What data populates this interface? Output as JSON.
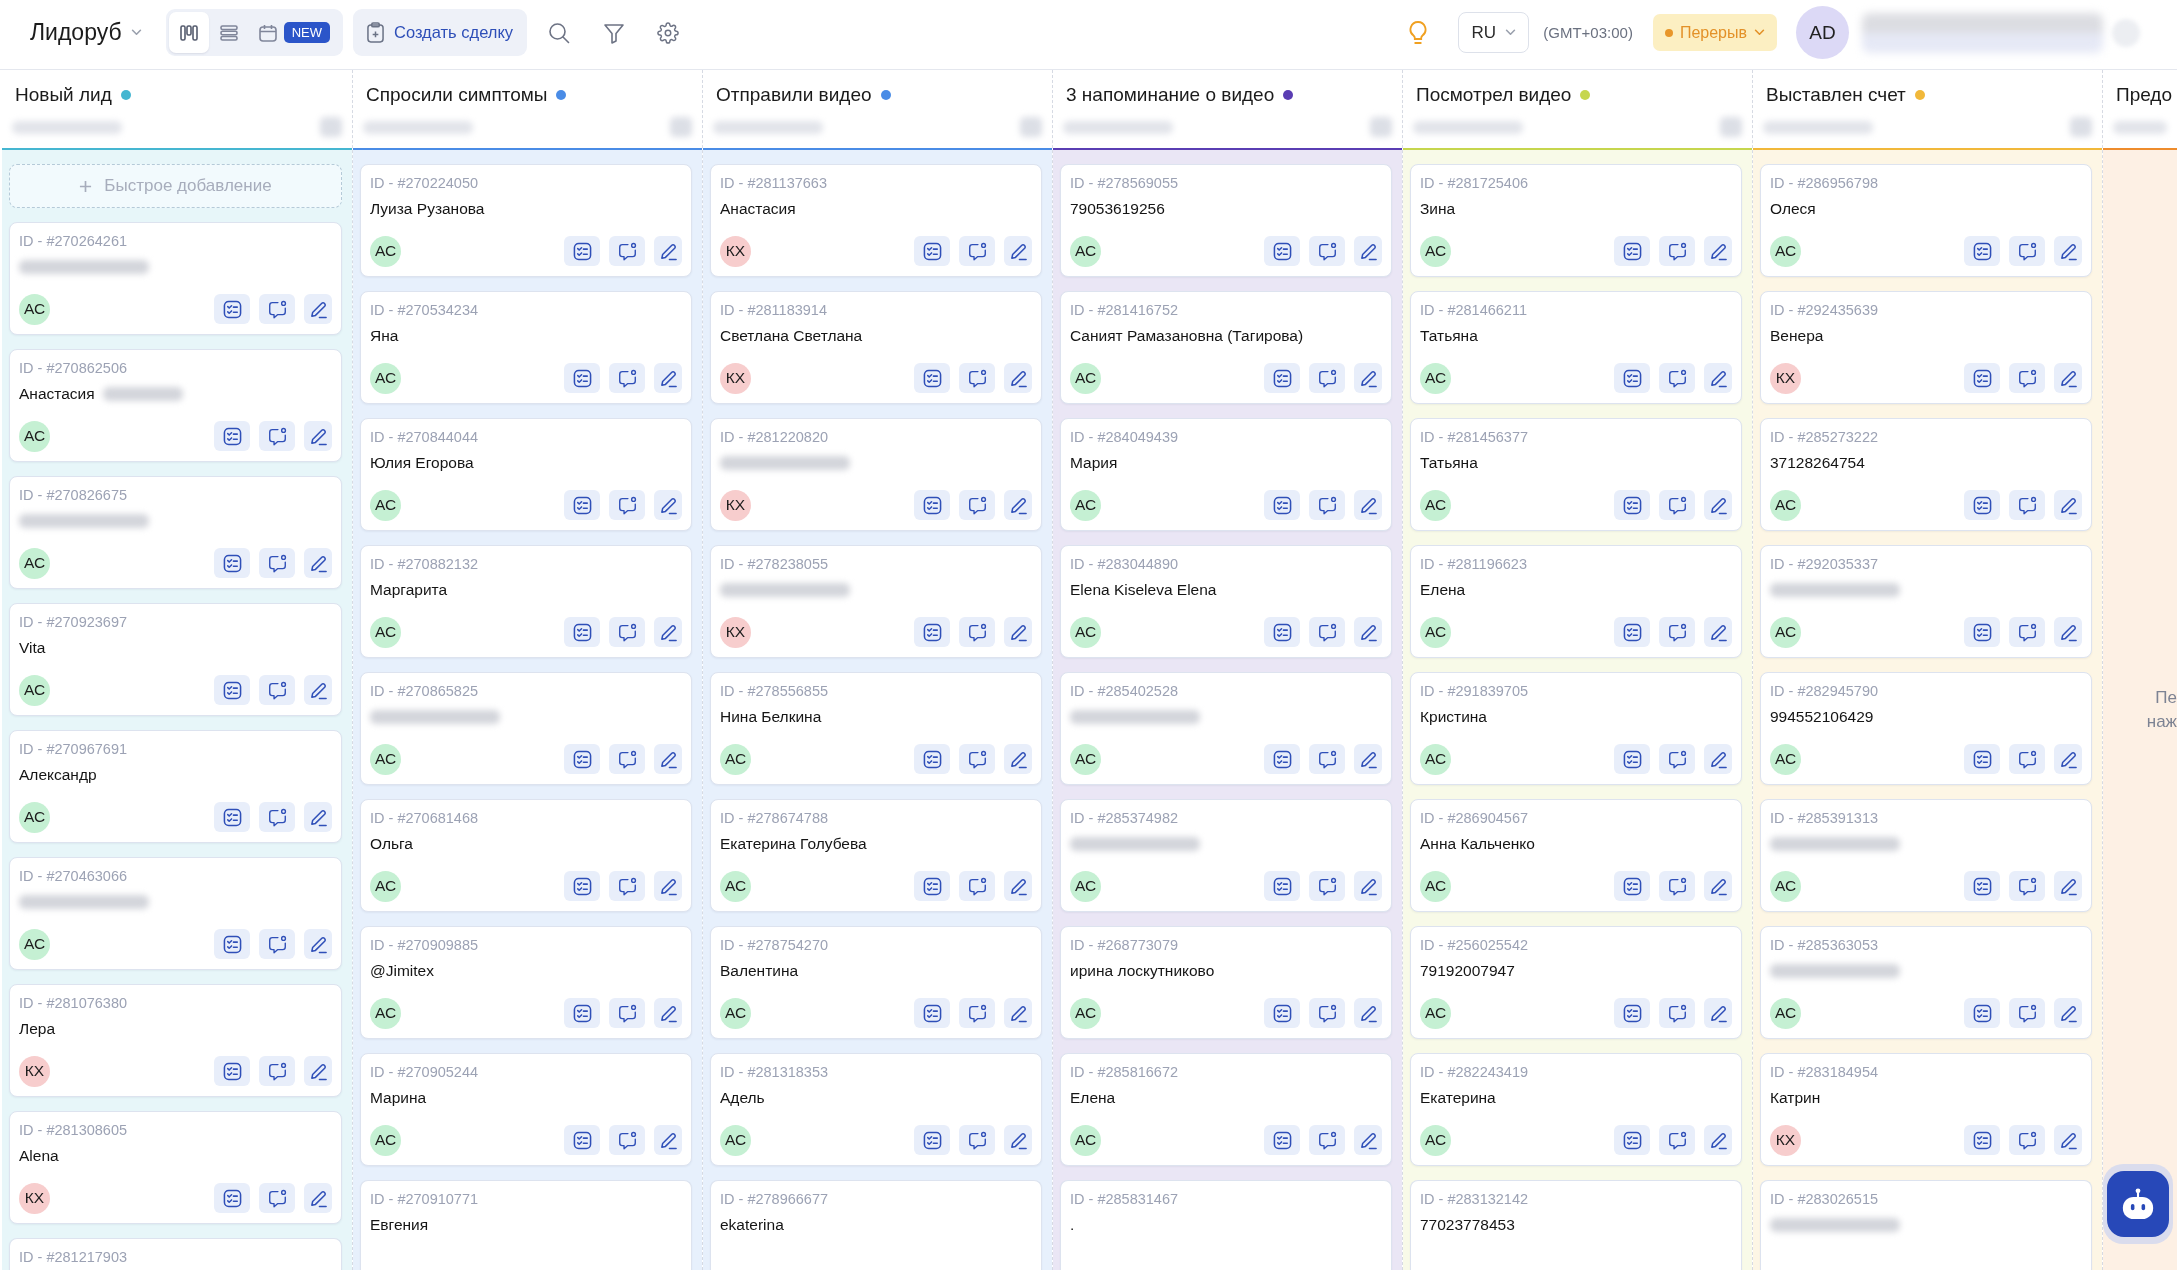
{
  "top_bar": {
    "workspace": "Лидоруб",
    "views": [
      {
        "kind": "board",
        "selected": true
      },
      {
        "kind": "list",
        "selected": false
      },
      {
        "kind": "calendar",
        "selected": false,
        "badge": "NEW"
      }
    ],
    "create_button": "Создать сделку",
    "language": "RU",
    "timezone": "(GMT+03:00)",
    "status": "Перерыв",
    "user_initials": "AD"
  },
  "board": {
    "columns": [
      {
        "kind": "cards",
        "title": "Новый лид",
        "color": "#45b6d1",
        "quick_add": "Быстрое добавление",
        "cards": [
          {
            "id": "ID - #270264261",
            "redacted": true,
            "avatar": {
              "initials": "АС",
              "color": "#c5f0d3"
            }
          },
          {
            "id": "ID - #270862506",
            "name": "Анастасия",
            "redacted": true,
            "avatar": {
              "initials": "АС",
              "color": "#c5f0d3"
            }
          },
          {
            "id": "ID - #270826675",
            "redacted": true,
            "avatar": {
              "initials": "АС",
              "color": "#c5f0d3"
            }
          },
          {
            "id": "ID - #270923697",
            "name": "Vita",
            "redacted": false,
            "avatar": {
              "initials": "АС",
              "color": "#c5f0d3"
            }
          },
          {
            "id": "ID - #270967691",
            "name": "Александр",
            "redacted": false,
            "avatar": {
              "initials": "АС",
              "color": "#c5f0d3"
            }
          },
          {
            "id": "ID - #270463066",
            "redacted": true,
            "avatar": {
              "initials": "АС",
              "color": "#c5f0d3"
            }
          },
          {
            "id": "ID - #281076380",
            "name": "Лера",
            "redacted": false,
            "avatar": {
              "initials": "КХ",
              "color": "#f7cdcd"
            }
          },
          {
            "id": "ID - #281308605",
            "name": "Alena",
            "redacted": false,
            "avatar": {
              "initials": "КХ",
              "color": "#f7cdcd"
            }
          },
          {
            "id": "ID - #281217903",
            "redacted": false
          }
        ]
      },
      {
        "kind": "cards",
        "title": "Спросили симптомы",
        "color": "#4a8ce6",
        "cards": [
          {
            "id": "ID - #270224050",
            "name": "Луиза Рузанова",
            "redacted": false,
            "avatar": {
              "initials": "АС",
              "color": "#c5f0d3"
            }
          },
          {
            "id": "ID - #270534234",
            "name": "Яна",
            "redacted": false,
            "avatar": {
              "initials": "АС",
              "color": "#c5f0d3"
            }
          },
          {
            "id": "ID - #270844044",
            "name": "Юлия Егорова",
            "redacted": false,
            "avatar": {
              "initials": "АС",
              "color": "#c5f0d3"
            }
          },
          {
            "id": "ID - #270882132",
            "name": "Маргарита",
            "redacted": false,
            "avatar": {
              "initials": "АС",
              "color": "#c5f0d3"
            }
          },
          {
            "id": "ID - #270865825",
            "redacted": true,
            "avatar": {
              "initials": "АС",
              "color": "#c5f0d3"
            }
          },
          {
            "id": "ID - #270681468",
            "name": "Ольга",
            "redacted": false,
            "avatar": {
              "initials": "АС",
              "color": "#c5f0d3"
            }
          },
          {
            "id": "ID - #270909885",
            "name": "@Jimitex",
            "redacted": false,
            "avatar": {
              "initials": "АС",
              "color": "#c5f0d3"
            }
          },
          {
            "id": "ID - #270905244",
            "name": "Марина",
            "redacted": false,
            "avatar": {
              "initials": "АС",
              "color": "#c5f0d3"
            }
          },
          {
            "id": "ID - #270910771",
            "name": "Евгения",
            "redacted": false
          }
        ]
      },
      {
        "kind": "cards",
        "title": "Отправили видео",
        "color": "#4a8ce6",
        "cards": [
          {
            "id": "ID - #281137663",
            "name": "Анастасия",
            "redacted": false,
            "avatar": {
              "initials": "КХ",
              "color": "#f7cdcd"
            }
          },
          {
            "id": "ID - #281183914",
            "name": "Светлана Светлана",
            "redacted": false,
            "avatar": {
              "initials": "КХ",
              "color": "#f7cdcd"
            }
          },
          {
            "id": "ID - #281220820",
            "redacted": true,
            "avatar": {
              "initials": "КХ",
              "color": "#f7cdcd"
            }
          },
          {
            "id": "ID - #278238055",
            "redacted": true,
            "avatar": {
              "initials": "КХ",
              "color": "#f7cdcd"
            }
          },
          {
            "id": "ID - #278556855",
            "name": "Нина Белкина",
            "redacted": false,
            "avatar": {
              "initials": "АС",
              "color": "#c5f0d3"
            }
          },
          {
            "id": "ID - #278674788",
            "name": "Екатерина Голубева",
            "redacted": false,
            "avatar": {
              "initials": "АС",
              "color": "#c5f0d3"
            }
          },
          {
            "id": "ID - #278754270",
            "name": "Валентина",
            "redacted": false,
            "avatar": {
              "initials": "АС",
              "color": "#c5f0d3"
            }
          },
          {
            "id": "ID - #281318353",
            "name": "Адель",
            "redacted": false,
            "avatar": {
              "initials": "АС",
              "color": "#c5f0d3"
            }
          },
          {
            "id": "ID - #278966677",
            "name": "ekaterina",
            "redacted": false
          }
        ]
      },
      {
        "kind": "cards",
        "title": "3 напоминание о видео",
        "color": "#5a3db3",
        "cards": [
          {
            "id": "ID - #278569055",
            "name": "79053619256",
            "redacted": false,
            "avatar": {
              "initials": "АС",
              "color": "#c5f0d3"
            }
          },
          {
            "id": "ID - #281416752",
            "name": "Саният Рамазановна (Тагирова)",
            "redacted": false,
            "avatar": {
              "initials": "АС",
              "color": "#c5f0d3"
            }
          },
          {
            "id": "ID - #284049439",
            "name": "Мария",
            "redacted": false,
            "avatar": {
              "initials": "АС",
              "color": "#c5f0d3"
            }
          },
          {
            "id": "ID - #283044890",
            "name": "Elena Kiseleva Elena",
            "redacted": false,
            "avatar": {
              "initials": "АС",
              "color": "#c5f0d3"
            }
          },
          {
            "id": "ID - #285402528",
            "redacted": true,
            "avatar": {
              "initials": "АС",
              "color": "#c5f0d3"
            }
          },
          {
            "id": "ID - #285374982",
            "redacted": true,
            "avatar": {
              "initials": "АС",
              "color": "#c5f0d3"
            }
          },
          {
            "id": "ID - #268773079",
            "name": "ирина лоскутниково",
            "redacted": false,
            "avatar": {
              "initials": "АС",
              "color": "#c5f0d3"
            }
          },
          {
            "id": "ID - #285816672",
            "name": "Елена",
            "redacted": false,
            "avatar": {
              "initials": "АС",
              "color": "#c5f0d3"
            }
          },
          {
            "id": "ID - #285831467",
            "name": ".",
            "redacted": false
          }
        ]
      },
      {
        "kind": "cards",
        "title": "Посмотрел видео",
        "color": "#c6d64e",
        "cards": [
          {
            "id": "ID - #281725406",
            "name": "Зина",
            "redacted": false,
            "avatar": {
              "initials": "АС",
              "color": "#c5f0d3"
            }
          },
          {
            "id": "ID - #281466211",
            "name": "Татьяна",
            "redacted": false,
            "avatar": {
              "initials": "АС",
              "color": "#c5f0d3"
            }
          },
          {
            "id": "ID - #281456377",
            "name": "Татьяна",
            "redacted": false,
            "avatar": {
              "initials": "АС",
              "color": "#c5f0d3"
            }
          },
          {
            "id": "ID - #281196623",
            "name": "Елена",
            "redacted": false,
            "avatar": {
              "initials": "АС",
              "color": "#c5f0d3"
            }
          },
          {
            "id": "ID - #291839705",
            "name": "Кристина",
            "redacted": false,
            "avatar": {
              "initials": "АС",
              "color": "#c5f0d3"
            }
          },
          {
            "id": "ID - #286904567",
            "name": "Анна Кальченко",
            "redacted": false,
            "avatar": {
              "initials": "АС",
              "color": "#c5f0d3"
            }
          },
          {
            "id": "ID - #256025542",
            "name": "79192007947",
            "redacted": false,
            "avatar": {
              "initials": "АС",
              "color": "#c5f0d3"
            }
          },
          {
            "id": "ID - #282243419",
            "name": "Екатерина",
            "redacted": false,
            "avatar": {
              "initials": "АС",
              "color": "#c5f0d3"
            }
          },
          {
            "id": "ID - #283132142",
            "name": "77023778453",
            "redacted": false
          }
        ]
      },
      {
        "kind": "cards",
        "title": "Выставлен счет",
        "color": "#f1b83a",
        "cards": [
          {
            "id": "ID - #286956798",
            "name": "Олеся",
            "redacted": false,
            "avatar": {
              "initials": "АС",
              "color": "#c5f0d3"
            }
          },
          {
            "id": "ID - #292435639",
            "name": "Венера",
            "redacted": false,
            "avatar": {
              "initials": "КХ",
              "color": "#f7cdcd"
            }
          },
          {
            "id": "ID - #285273222",
            "name": "37128264754",
            "redacted": false,
            "avatar": {
              "initials": "АС",
              "color": "#c5f0d3"
            }
          },
          {
            "id": "ID - #292035337",
            "redacted": true,
            "avatar": {
              "initials": "АС",
              "color": "#c5f0d3"
            }
          },
          {
            "id": "ID - #282945790",
            "name": "994552106429",
            "redacted": false,
            "avatar": {
              "initials": "АС",
              "color": "#c5f0d3"
            }
          },
          {
            "id": "ID - #285391313",
            "redacted": true,
            "avatar": {
              "initials": "АС",
              "color": "#c5f0d3"
            }
          },
          {
            "id": "ID - #285363053",
            "redacted": true,
            "avatar": {
              "initials": "АС",
              "color": "#c5f0d3"
            }
          },
          {
            "id": "ID - #283184954",
            "name": "Катрин",
            "redacted": false,
            "avatar": {
              "initials": "КХ",
              "color": "#f7cdcd"
            }
          },
          {
            "id": "ID - #283026515",
            "redacted": true
          }
        ]
      },
      {
        "kind": "partial",
        "title": "Предо",
        "color": "#ee8c2c",
        "empty_text": [
          "Пе",
          "наж"
        ]
      }
    ]
  }
}
